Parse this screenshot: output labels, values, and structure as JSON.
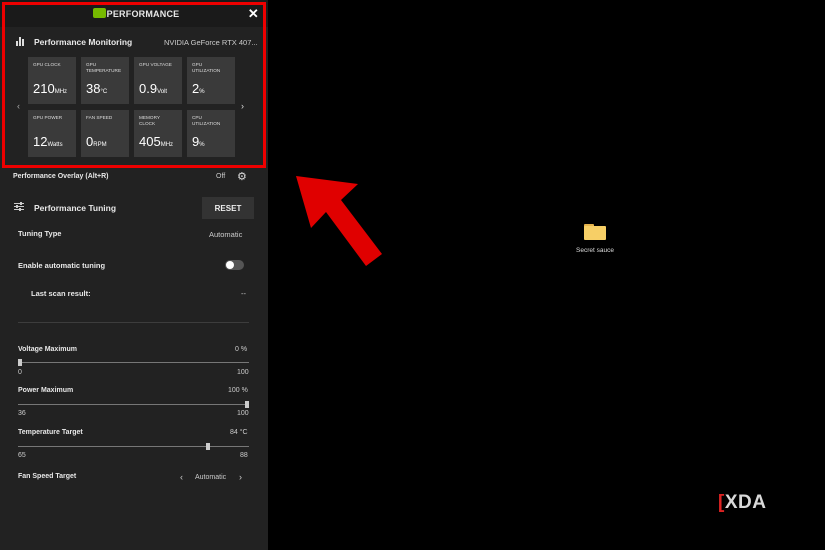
{
  "window": {
    "title": "PERFORMANCE"
  },
  "monitoring": {
    "title": "Performance Monitoring",
    "gpu_name": "NVIDIA GeForce RTX 407...",
    "tiles": [
      {
        "label": "GPU CLOCK",
        "value": "210",
        "unit": "MHz"
      },
      {
        "label": "GPU TEMPERATURE",
        "value": "38",
        "unit": "°C"
      },
      {
        "label": "GPU VOLTAGE",
        "value": "0.9",
        "unit": "Volt"
      },
      {
        "label": "GPU UTILIZATION",
        "value": "2",
        "unit": "%"
      },
      {
        "label": "GPU POWER",
        "value": "12",
        "unit": "Watts"
      },
      {
        "label": "FAN SPEED",
        "value": "0",
        "unit": "RPM"
      },
      {
        "label": "MEMORY CLOCK",
        "value": "405",
        "unit": "MHz"
      },
      {
        "label": "CPU UTILIZATION",
        "value": "9",
        "unit": "%"
      }
    ],
    "prev": "‹",
    "next": "›"
  },
  "overlay": {
    "label": "Performance Overlay (Alt+R)",
    "state": "Off"
  },
  "tuning": {
    "title": "Performance Tuning",
    "reset_label": "RESET",
    "type_label": "Tuning Type",
    "type_value": "Automatic",
    "auto_label": "Enable automatic tuning",
    "auto_on": false,
    "scan_label": "Last scan result:",
    "scan_value": "--",
    "sliders": [
      {
        "label": "Voltage Maximum",
        "value": "0 %",
        "min": "0",
        "max": "100",
        "fraction": 0
      },
      {
        "label": "Power Maximum",
        "value": "100 %",
        "min": "36",
        "max": "100",
        "fraction": 1
      },
      {
        "label": "Temperature Target",
        "value": "84 °C",
        "min": "65",
        "max": "88",
        "fraction": 0.83
      }
    ],
    "fan_label": "Fan Speed Target",
    "fan_value": "Automatic",
    "fan_prev": "‹",
    "fan_next": "›"
  },
  "desktop": {
    "folder_label": "Secret sauce"
  },
  "watermark": {
    "bracket": "[",
    "text": "XDA"
  },
  "colors": {
    "accent": "#76b900",
    "highlight": "#e00000"
  }
}
